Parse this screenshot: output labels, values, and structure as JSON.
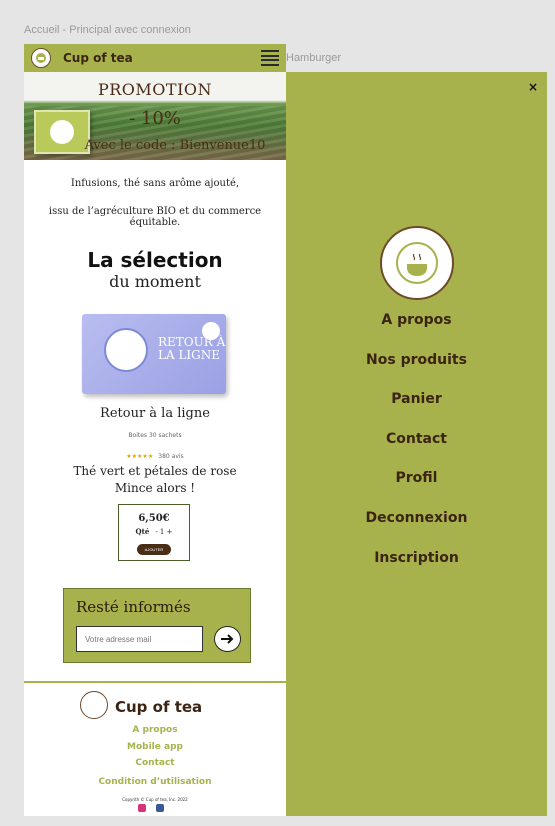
{
  "frames": {
    "left_label": "Accueil - Principal avec connexion",
    "right_label": "Hamburger"
  },
  "header": {
    "brand": "Cup of tea"
  },
  "promo": {
    "title": "PROMOTION",
    "percent": "- 10%",
    "code": "Avec le code : Bienvenue10"
  },
  "intro": {
    "line1": "Infusions, thé sans arôme ajouté,",
    "line2": "issu de l’agréculture BIO et du commerce équitable."
  },
  "selection": {
    "title": "La sélection",
    "subtitle": "du moment"
  },
  "product": {
    "package_title": "RETOUR À LA LIGNE",
    "name": "Retour à la ligne",
    "meta": "Boites 30 sachets",
    "stars": "★★★★★",
    "reviews": "380 avis",
    "desc1": "Thé vert et pétales de rose",
    "desc2": "Mince alors !",
    "price": "6,50€",
    "qty_label": "Qté",
    "qty_value": "- 1 +",
    "add_label": "AJOUTER"
  },
  "newsletter": {
    "title": "Resté informés",
    "placeholder": "Votre adresse mail"
  },
  "footer": {
    "brand": "Cup of tea",
    "links": [
      "A propos",
      "Mobile app",
      "Contact",
      "Condition d’utilisation"
    ],
    "copyright": "Copyrith © Cup of tea, Inc. 2022"
  },
  "menu": {
    "close": "×",
    "items": [
      "A propos",
      "Nos produits",
      "Panier",
      "Contact",
      "Profil",
      "Deconnexion",
      "Inscription"
    ]
  },
  "colors": {
    "accent": "#a8b24c",
    "brown": "#3b2414"
  }
}
